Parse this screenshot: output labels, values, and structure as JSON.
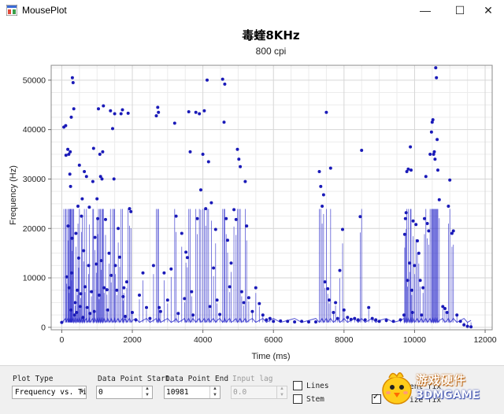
{
  "window": {
    "title": "MousePlot",
    "minimize": "—",
    "maximize": "☐",
    "close": "✕"
  },
  "chart_data": {
    "type": "scatter",
    "title": "毒蝰8KHz",
    "subtitle": "800 cpi",
    "xlabel": "Time (ms)",
    "ylabel": "Frequency (Hz)",
    "xlim": [
      -300,
      12200
    ],
    "ylim": [
      -500,
      53000
    ],
    "xticks": [
      0,
      2000,
      4000,
      6000,
      8000,
      10000,
      12000
    ],
    "yticks": [
      0,
      10000,
      20000,
      30000,
      40000,
      50000
    ],
    "grid": true,
    "marker_color": "#1a1ab8",
    "line_color": "#2424c8",
    "series": [
      {
        "points": [
          [
            0,
            1000
          ],
          [
            60,
            40500
          ],
          [
            110,
            40800
          ],
          [
            120,
            34800
          ],
          [
            140,
            10200
          ],
          [
            170,
            36000
          ],
          [
            180,
            20500
          ],
          [
            200,
            35000
          ],
          [
            210,
            8000
          ],
          [
            230,
            31000
          ],
          [
            240,
            35500
          ],
          [
            250,
            28500
          ],
          [
            260,
            3500
          ],
          [
            270,
            42500
          ],
          [
            280,
            11000
          ],
          [
            290,
            18000
          ],
          [
            300,
            50500
          ],
          [
            320,
            49500
          ],
          [
            340,
            44200
          ],
          [
            360,
            2500
          ],
          [
            380,
            5000
          ],
          [
            400,
            19000
          ],
          [
            420,
            3000
          ],
          [
            440,
            7500
          ],
          [
            460,
            24500
          ],
          [
            480,
            14000
          ],
          [
            500,
            32800
          ],
          [
            520,
            4200
          ],
          [
            540,
            6800
          ],
          [
            560,
            22500
          ],
          [
            580,
            26000
          ],
          [
            600,
            2000
          ],
          [
            620,
            15500
          ],
          [
            640,
            31500
          ],
          [
            660,
            8200
          ],
          [
            700,
            30500
          ],
          [
            720,
            4000
          ],
          [
            760,
            12500
          ],
          [
            780,
            24300
          ],
          [
            800,
            2800
          ],
          [
            840,
            7200
          ],
          [
            880,
            29500
          ],
          [
            900,
            36200
          ],
          [
            920,
            3200
          ],
          [
            940,
            18200
          ],
          [
            980,
            12800
          ],
          [
            1000,
            26000
          ],
          [
            1020,
            22000
          ],
          [
            1040,
            44200
          ],
          [
            1060,
            6500
          ],
          [
            1080,
            35000
          ],
          [
            1100,
            30500
          ],
          [
            1120,
            13500
          ],
          [
            1140,
            30000
          ],
          [
            1160,
            35500
          ],
          [
            1180,
            44800
          ],
          [
            1200,
            8000
          ],
          [
            1240,
            21800
          ],
          [
            1280,
            7600
          ],
          [
            1300,
            3500
          ],
          [
            1340,
            15000
          ],
          [
            1380,
            43800
          ],
          [
            1400,
            10500
          ],
          [
            1440,
            40200
          ],
          [
            1480,
            30000
          ],
          [
            1500,
            43200
          ],
          [
            1520,
            12500
          ],
          [
            1560,
            7500
          ],
          [
            1600,
            20000
          ],
          [
            1640,
            14200
          ],
          [
            1680,
            43200
          ],
          [
            1720,
            44000
          ],
          [
            1740,
            6200
          ],
          [
            1760,
            8000
          ],
          [
            1800,
            2200
          ],
          [
            1840,
            9200
          ],
          [
            1880,
            43300
          ],
          [
            1920,
            24000
          ],
          [
            1960,
            23400
          ],
          [
            2000,
            3000
          ],
          [
            2100,
            1500
          ],
          [
            2200,
            6500
          ],
          [
            2300,
            11000
          ],
          [
            2400,
            4000
          ],
          [
            2500,
            1800
          ],
          [
            2600,
            12500
          ],
          [
            2680,
            42800
          ],
          [
            2720,
            44500
          ],
          [
            2740,
            43500
          ],
          [
            2760,
            4000
          ],
          [
            2800,
            3200
          ],
          [
            2900,
            11000
          ],
          [
            3000,
            5500
          ],
          [
            3100,
            11800
          ],
          [
            3200,
            41300
          ],
          [
            3240,
            22500
          ],
          [
            3300,
            2800
          ],
          [
            3400,
            19000
          ],
          [
            3480,
            5800
          ],
          [
            3520,
            15200
          ],
          [
            3560,
            14100
          ],
          [
            3600,
            43600
          ],
          [
            3640,
            35500
          ],
          [
            3680,
            7200
          ],
          [
            3720,
            2500
          ],
          [
            3800,
            43500
          ],
          [
            3840,
            22000
          ],
          [
            3900,
            43200
          ],
          [
            3940,
            27800
          ],
          [
            4000,
            35000
          ],
          [
            4040,
            43800
          ],
          [
            4080,
            24000
          ],
          [
            4120,
            50000
          ],
          [
            4160,
            33500
          ],
          [
            4200,
            4200
          ],
          [
            4240,
            25200
          ],
          [
            4300,
            12000
          ],
          [
            4360,
            19800
          ],
          [
            4400,
            5500
          ],
          [
            4480,
            2600
          ],
          [
            4560,
            50200
          ],
          [
            4600,
            41500
          ],
          [
            4620,
            49200
          ],
          [
            4660,
            22000
          ],
          [
            4700,
            17600
          ],
          [
            4760,
            8200
          ],
          [
            4800,
            13000
          ],
          [
            4880,
            23800
          ],
          [
            4940,
            21800
          ],
          [
            4980,
            36000
          ],
          [
            5020,
            34000
          ],
          [
            5060,
            32500
          ],
          [
            5100,
            7200
          ],
          [
            5160,
            5000
          ],
          [
            5200,
            29500
          ],
          [
            5240,
            20500
          ],
          [
            5300,
            6000
          ],
          [
            5400,
            3200
          ],
          [
            5500,
            8000
          ],
          [
            5600,
            4800
          ],
          [
            5700,
            2500
          ],
          [
            5800,
            1500
          ],
          [
            5900,
            1800
          ],
          [
            6000,
            1200
          ],
          [
            6200,
            1300
          ],
          [
            6400,
            1200
          ],
          [
            6600,
            1100
          ],
          [
            6800,
            1200
          ],
          [
            7000,
            1100
          ],
          [
            7200,
            1100
          ],
          [
            7300,
            31500
          ],
          [
            7340,
            28500
          ],
          [
            7380,
            24500
          ],
          [
            7420,
            26800
          ],
          [
            7460,
            9200
          ],
          [
            7500,
            43500
          ],
          [
            7540,
            7800
          ],
          [
            7580,
            5500
          ],
          [
            7620,
            32200
          ],
          [
            7700,
            3000
          ],
          [
            7760,
            5000
          ],
          [
            7820,
            1800
          ],
          [
            7880,
            11500
          ],
          [
            7960,
            19800
          ],
          [
            8000,
            3500
          ],
          [
            8100,
            2000
          ],
          [
            8200,
            1600
          ],
          [
            8300,
            1800
          ],
          [
            8400,
            1500
          ],
          [
            8460,
            22400
          ],
          [
            8500,
            35800
          ],
          [
            8600,
            1500
          ],
          [
            8700,
            4000
          ],
          [
            8800,
            1800
          ],
          [
            8900,
            1500
          ],
          [
            9000,
            1200
          ],
          [
            9200,
            1400
          ],
          [
            9400,
            1200
          ],
          [
            9600,
            1500
          ],
          [
            9700,
            2500
          ],
          [
            9720,
            18800
          ],
          [
            9740,
            22000
          ],
          [
            9760,
            23200
          ],
          [
            9780,
            31500
          ],
          [
            9800,
            9500
          ],
          [
            9820,
            32000
          ],
          [
            9860,
            13000
          ],
          [
            9880,
            36500
          ],
          [
            9900,
            31800
          ],
          [
            9920,
            7500
          ],
          [
            9940,
            3000
          ],
          [
            9960,
            21500
          ],
          [
            10000,
            12500
          ],
          [
            10040,
            20800
          ],
          [
            10080,
            17500
          ],
          [
            10120,
            15000
          ],
          [
            10160,
            9500
          ],
          [
            10200,
            2500
          ],
          [
            10240,
            8000
          ],
          [
            10280,
            22000
          ],
          [
            10320,
            30500
          ],
          [
            10360,
            21000
          ],
          [
            10400,
            19500
          ],
          [
            10440,
            35000
          ],
          [
            10480,
            39500
          ],
          [
            10500,
            41500
          ],
          [
            10520,
            42000
          ],
          [
            10540,
            35000
          ],
          [
            10560,
            35500
          ],
          [
            10580,
            34000
          ],
          [
            10600,
            52500
          ],
          [
            10620,
            50500
          ],
          [
            10640,
            38000
          ],
          [
            10660,
            31800
          ],
          [
            10700,
            25800
          ],
          [
            10800,
            4200
          ],
          [
            10860,
            3800
          ],
          [
            10920,
            3000
          ],
          [
            10960,
            24500
          ],
          [
            11000,
            29800
          ],
          [
            11060,
            19000
          ],
          [
            11100,
            19500
          ],
          [
            11200,
            2500
          ],
          [
            11300,
            1200
          ],
          [
            11400,
            500
          ],
          [
            11500,
            200
          ],
          [
            11600,
            100
          ]
        ]
      }
    ]
  },
  "controls": {
    "plot_type": {
      "label": "Plot Type",
      "value": "Frequency vs. Ti",
      "caret": "▾"
    },
    "data_point_start": {
      "label": "Data Point Start",
      "value": "0",
      "up": "▲",
      "down": "▼"
    },
    "data_point_end": {
      "label": "Data Point End",
      "value": "10981",
      "up": "▲",
      "down": "▼"
    },
    "input_lag": {
      "label": "Input lag",
      "value": "0.0",
      "up": "▲",
      "down": "▼"
    },
    "lines": {
      "label": "Lines",
      "checked": false
    },
    "stem": {
      "label": "Stem",
      "checked": false
    },
    "partial_label_top": "ent fix",
    "partial_label_bottom": "ize fix"
  },
  "watermark": {
    "line1": "游戏硬件",
    "line2": "3DMGAME"
  }
}
